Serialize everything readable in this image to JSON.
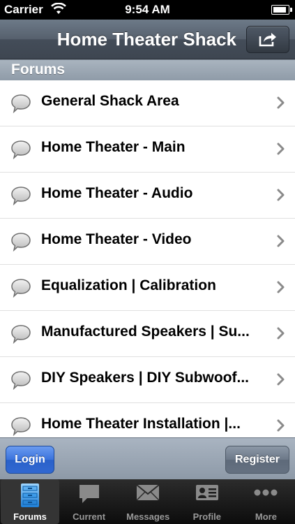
{
  "status_bar": {
    "carrier": "Carrier",
    "time": "9:54 AM",
    "battery_level": 0.9
  },
  "nav": {
    "title": "Home Theater Shack"
  },
  "section": {
    "title": "Forums"
  },
  "forums": [
    {
      "label": "General Shack Area"
    },
    {
      "label": "Home Theater - Main"
    },
    {
      "label": "Home Theater - Audio"
    },
    {
      "label": "Home Theater - Video"
    },
    {
      "label": "Equalization | Calibration"
    },
    {
      "label": "Manufactured Speakers | Su..."
    },
    {
      "label": "DIY Speakers | DIY Subwoof..."
    },
    {
      "label": "Home Theater Installation |..."
    }
  ],
  "buttons": {
    "login": "Login",
    "register": "Register"
  },
  "tabs": [
    {
      "label": "Forums",
      "icon": "cabinet-icon",
      "active": true
    },
    {
      "label": "Current",
      "icon": "speech-bubble-icon",
      "active": false
    },
    {
      "label": "Messages",
      "icon": "envelope-icon",
      "active": false
    },
    {
      "label": "Profile",
      "icon": "id-card-icon",
      "active": false
    },
    {
      "label": "More",
      "icon": "more-dots-icon",
      "active": false
    }
  ],
  "colors": {
    "login_blue": "#3a73dc",
    "nav_bar": "#4f5966",
    "section_header": "#9aa6b3"
  }
}
